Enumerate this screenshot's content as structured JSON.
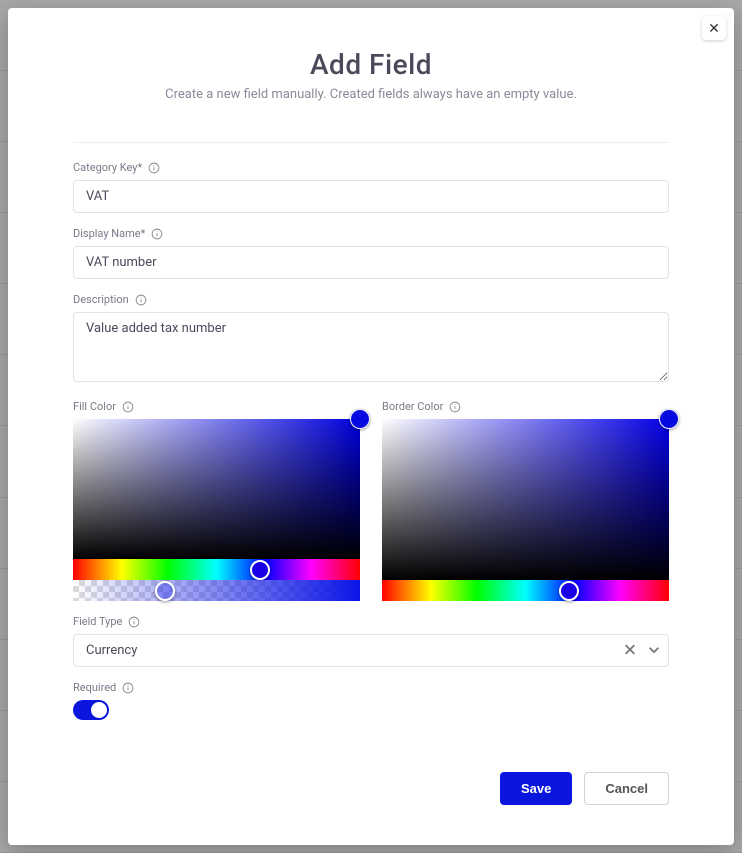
{
  "header": {
    "title": "Add Field",
    "subtitle": "Create a new field manually. Created fields always have an empty value."
  },
  "labels": {
    "category_key": "Category Key*",
    "display_name": "Display Name*",
    "description": "Description",
    "fill_color": "Fill Color",
    "border_color": "Border Color",
    "field_type": "Field Type",
    "required": "Required"
  },
  "values": {
    "category_key": "VAT",
    "display_name": "VAT number",
    "description": "Value added tax number",
    "field_type": "Currency",
    "required": true,
    "fill_color_hex": "#050ae1",
    "border_color_hex": "#0500e6"
  },
  "buttons": {
    "save": "Save",
    "cancel": "Cancel",
    "close": "✕"
  }
}
